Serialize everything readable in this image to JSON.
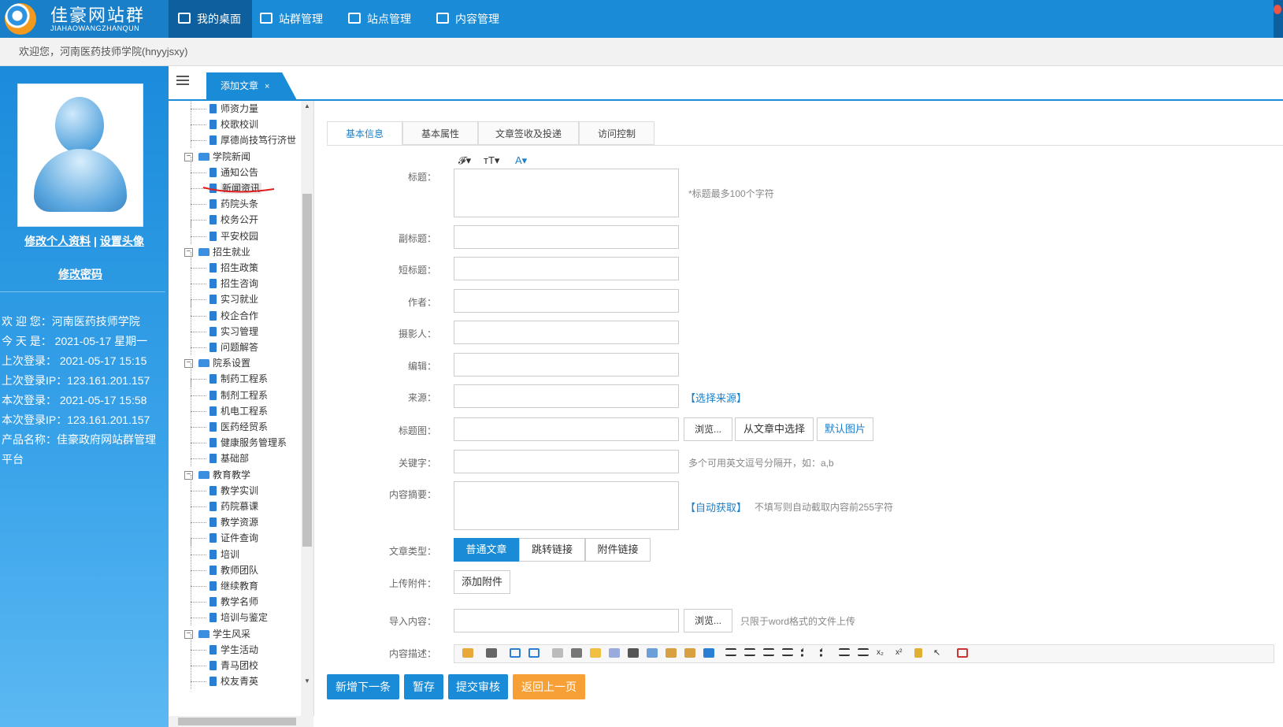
{
  "header": {
    "logo_name": "佳豪网站群",
    "logo_pinyin": "JIAHAOWANGZHANQUN",
    "nav": [
      {
        "label": "我的桌面",
        "icon": "desktop-user-icon"
      },
      {
        "label": "站群管理",
        "icon": "monitor-icon"
      },
      {
        "label": "站点管理",
        "icon": "monitor-icon"
      },
      {
        "label": "内容管理",
        "icon": "monitor-icon"
      }
    ],
    "brand_color": "#1a8bd6"
  },
  "welcome_text": "欢迎您，河南医药技师学院(hnyyjsxy)",
  "sidebar": {
    "edit_profile": "修改个人资料",
    "separator": "|",
    "set_avatar": "设置头像",
    "change_password": "修改密码",
    "info": [
      "欢 迎 您：河南医药技师学院",
      "今 天 是： 2021-05-17 星期一",
      "上次登录： 2021-05-17 15:15",
      "上次登录IP：123.161.201.157",
      "本次登录： 2021-05-17 15:58",
      "本次登录IP：123.161.201.157",
      "产品名称：佳豪政府网站群管理",
      "平台"
    ]
  },
  "tabs": {
    "active_tab": "添加文章",
    "close": "×"
  },
  "tree": {
    "nodes": [
      {
        "label": "师资力量",
        "type": "leaf"
      },
      {
        "label": "校歌校训",
        "type": "leaf"
      },
      {
        "label": "厚德尚技笃行济世",
        "type": "leaf"
      },
      {
        "label": "学院新闻",
        "type": "folder"
      },
      {
        "label": "通知公告",
        "type": "leaf"
      },
      {
        "label": "新闻资讯",
        "type": "leaf",
        "selected": true
      },
      {
        "label": "药院头条",
        "type": "leaf"
      },
      {
        "label": "校务公开",
        "type": "leaf"
      },
      {
        "label": "平安校园",
        "type": "leaf"
      },
      {
        "label": "招生就业",
        "type": "folder"
      },
      {
        "label": "招生政策",
        "type": "leaf"
      },
      {
        "label": "招生咨询",
        "type": "leaf"
      },
      {
        "label": "实习就业",
        "type": "leaf"
      },
      {
        "label": "校企合作",
        "type": "leaf"
      },
      {
        "label": "实习管理",
        "type": "leaf"
      },
      {
        "label": "问题解答",
        "type": "leaf"
      },
      {
        "label": "院系设置",
        "type": "folder"
      },
      {
        "label": "制药工程系",
        "type": "leaf"
      },
      {
        "label": "制剂工程系",
        "type": "leaf"
      },
      {
        "label": "机电工程系",
        "type": "leaf"
      },
      {
        "label": "医药经贸系",
        "type": "leaf"
      },
      {
        "label": "健康服务管理系",
        "type": "leaf"
      },
      {
        "label": "基础部",
        "type": "leaf"
      },
      {
        "label": "教育教学",
        "type": "folder"
      },
      {
        "label": "教学实训",
        "type": "leaf"
      },
      {
        "label": "药院慕课",
        "type": "leaf"
      },
      {
        "label": "教学资源",
        "type": "leaf"
      },
      {
        "label": "证件查询",
        "type": "leaf"
      },
      {
        "label": "培训",
        "type": "leaf"
      },
      {
        "label": "教师团队",
        "type": "leaf"
      },
      {
        "label": "继续教育",
        "type": "leaf"
      },
      {
        "label": "教学名师",
        "type": "leaf"
      },
      {
        "label": "培训与鉴定",
        "type": "leaf"
      },
      {
        "label": "学生风采",
        "type": "folder"
      },
      {
        "label": "学生活动",
        "type": "leaf"
      },
      {
        "label": "青马团校",
        "type": "leaf"
      },
      {
        "label": "校友青英",
        "type": "leaf"
      }
    ]
  },
  "form": {
    "tabs": [
      "基本信息",
      "基本属性",
      "文章签收及投递",
      "访问控制"
    ],
    "title_label": "标题：",
    "title_hint": "*标题最多100个字符",
    "subtitle_label": "副标题：",
    "short_title_label": "短标题：",
    "author_label": "作者：",
    "photographer_label": "摄影人：",
    "editor_label": "编辑：",
    "source_label": "来源：",
    "choose_source": "【选择来源】",
    "title_image_label": "标题图：",
    "browse": "浏览...",
    "from_article": "从文章中选择",
    "default_image": "默认图片",
    "keywords_label": "关键字：",
    "keywords_hint": "多个可用英文逗号分隔开，如：a,b",
    "summary_label": "内容摘要：",
    "auto_get": "【自动获取】",
    "summary_hint": "不填写则自动截取内容前255字符",
    "article_type_label": "文章类型：",
    "article_types": [
      "普通文章",
      "跳转链接",
      "附件链接"
    ],
    "upload_label": "上传附件：",
    "add_attachment": "添加附件",
    "import_label": "导入内容：",
    "import_hint": "只限于word格式的文件上传",
    "content_desc_label": "内容描述："
  },
  "actions": {
    "save_next": "新增下一条",
    "draft": "暂存",
    "submit": "提交审核",
    "back": "返回上一页",
    "primary_color": "#1a8bd6",
    "back_color": "#f7a035"
  }
}
